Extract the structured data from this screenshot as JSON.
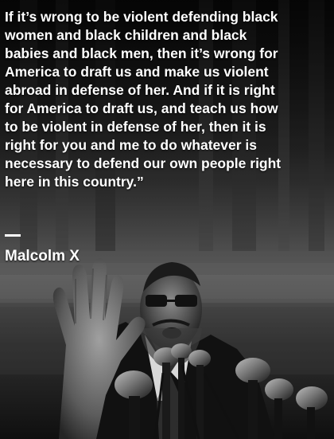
{
  "quote": {
    "lines": [
      " If it’s wrong to be violent defending black",
      "women and black children and black",
      "babies and black men, then it’s wrong for",
      "America to draft us and make us violent",
      "abroad in defense of her. And if it is right",
      "for America to draft us, and teach us how",
      "to be violent in defense of her, then it is",
      "right for you and me to do whatever is",
      "necessary to defend our own people right",
      "here in this country.”"
    ],
    "author": "Malcolm X"
  }
}
